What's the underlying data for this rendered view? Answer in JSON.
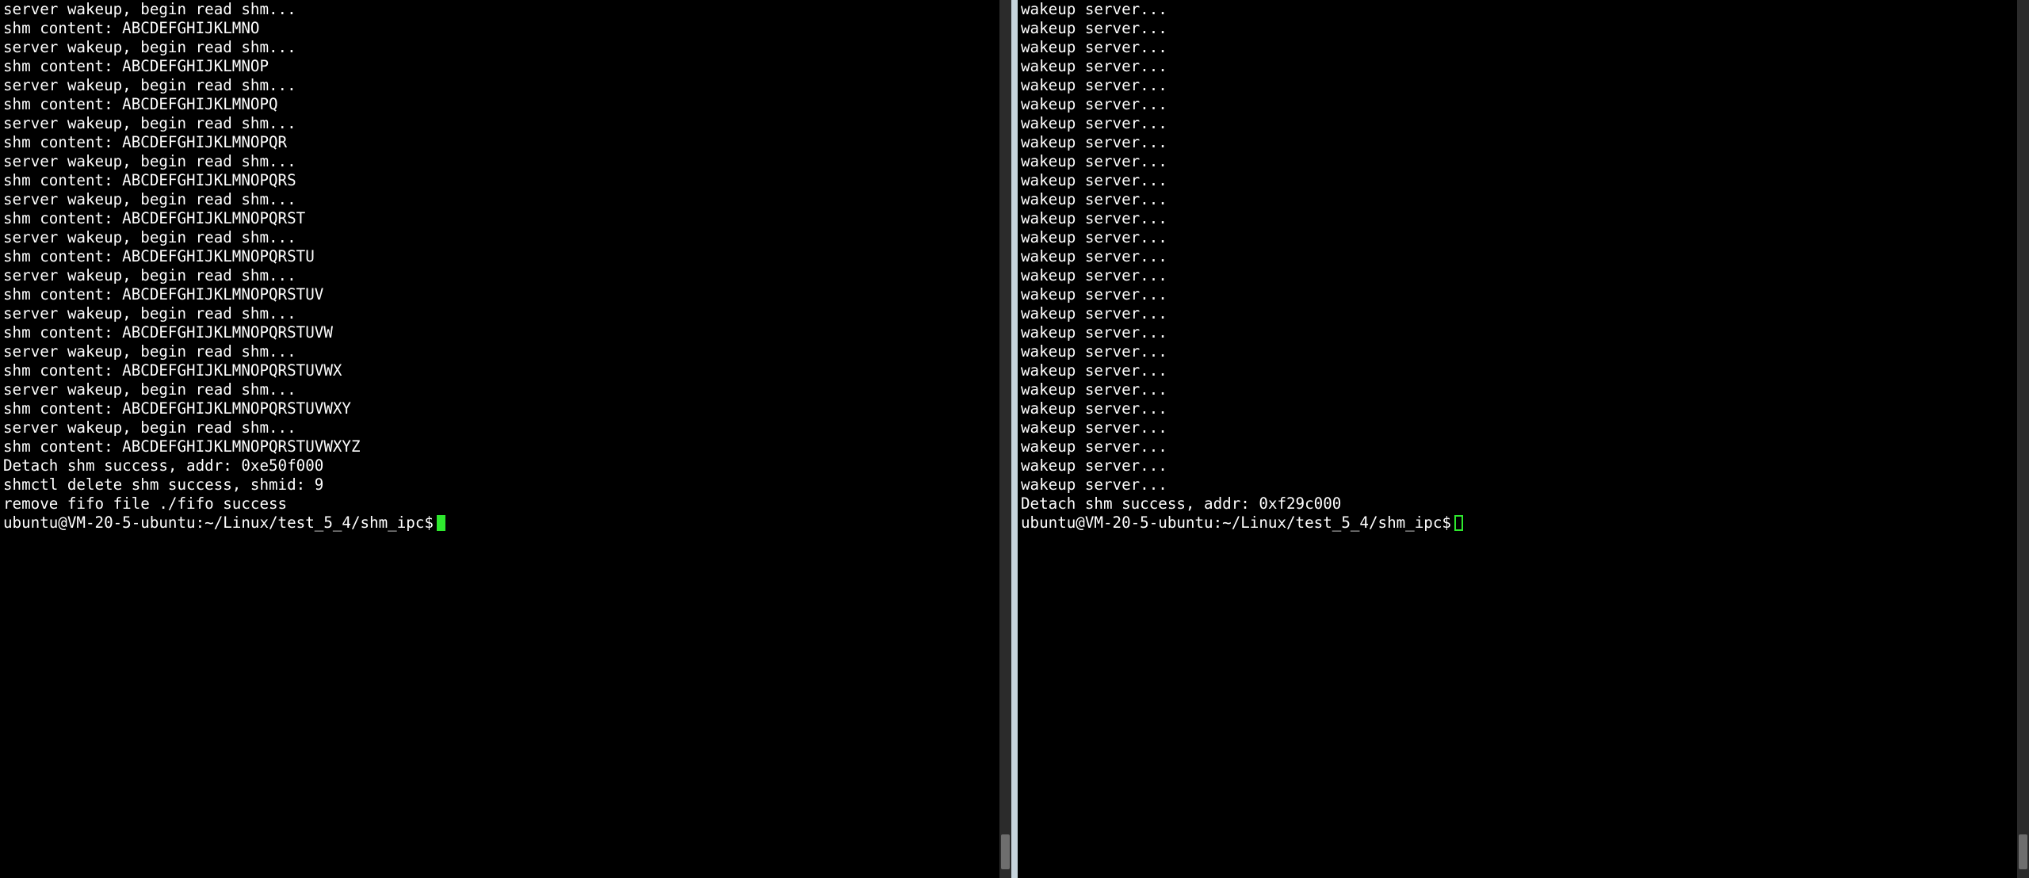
{
  "left": {
    "lines": [
      "server wakeup, begin read shm...",
      "shm content: ABCDEFGHIJKLMNO",
      "server wakeup, begin read shm...",
      "shm content: ABCDEFGHIJKLMNOP",
      "server wakeup, begin read shm...",
      "shm content: ABCDEFGHIJKLMNOPQ",
      "server wakeup, begin read shm...",
      "shm content: ABCDEFGHIJKLMNOPQR",
      "server wakeup, begin read shm...",
      "shm content: ABCDEFGHIJKLMNOPQRS",
      "server wakeup, begin read shm...",
      "shm content: ABCDEFGHIJKLMNOPQRST",
      "server wakeup, begin read shm...",
      "shm content: ABCDEFGHIJKLMNOPQRSTU",
      "server wakeup, begin read shm...",
      "shm content: ABCDEFGHIJKLMNOPQRSTUV",
      "server wakeup, begin read shm...",
      "shm content: ABCDEFGHIJKLMNOPQRSTUVW",
      "server wakeup, begin read shm...",
      "shm content: ABCDEFGHIJKLMNOPQRSTUVWX",
      "server wakeup, begin read shm...",
      "shm content: ABCDEFGHIJKLMNOPQRSTUVWXY",
      "server wakeup, begin read shm...",
      "shm content: ABCDEFGHIJKLMNOPQRSTUVWXYZ",
      "Detach shm success, addr: 0xe50f000",
      "shmctl delete shm success, shmid: 9",
      "remove fifo file ./fifo success"
    ],
    "prompt": "ubuntu@VM-20-5-ubuntu:~/Linux/test_5_4/shm_ipc$",
    "cursor_style": "solid",
    "scrollbar": {
      "thumb_top_pct": 95,
      "thumb_height_pct": 4
    }
  },
  "right": {
    "lines": [
      "wakeup server...",
      "wakeup server...",
      "wakeup server...",
      "wakeup server...",
      "wakeup server...",
      "wakeup server...",
      "wakeup server...",
      "wakeup server...",
      "wakeup server...",
      "wakeup server...",
      "wakeup server...",
      "wakeup server...",
      "wakeup server...",
      "wakeup server...",
      "wakeup server...",
      "wakeup server...",
      "wakeup server...",
      "wakeup server...",
      "wakeup server...",
      "wakeup server...",
      "wakeup server...",
      "wakeup server...",
      "wakeup server...",
      "wakeup server...",
      "wakeup server...",
      "wakeup server...",
      "Detach shm success, addr: 0xf29c000"
    ],
    "prompt": "ubuntu@VM-20-5-ubuntu:~/Linux/test_5_4/shm_ipc$",
    "cursor_style": "hollow",
    "scrollbar": {
      "thumb_top_pct": 95,
      "thumb_height_pct": 4
    }
  }
}
